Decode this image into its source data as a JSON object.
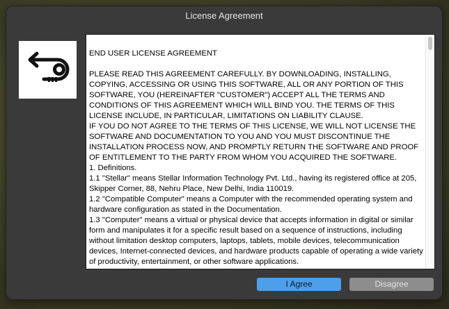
{
  "window": {
    "title": "License Agreement"
  },
  "logo": {
    "icon": "stellar-logo-icon"
  },
  "license": {
    "heading": "END USER LICENSE AGREEMENT",
    "paragraphs": [
      "PLEASE READ THIS AGREEMENT CAREFULLY. BY DOWNLOADING, INSTALLING, COPYING, ACCESSING OR USING THIS SOFTWARE, ALL OR ANY PORTION OF THIS SOFTWARE, YOU (HEREINAFTER \"CUSTOMER\") ACCEPT ALL THE TERMS AND CONDITIONS OF THIS AGREEMENT WHICH WILL BIND YOU. THE TERMS OF THIS LICENSE INCLUDE, IN PARTICULAR, LIMITATIONS ON LIABILITY CLAUSE.",
      "IF YOU DO NOT AGREE TO THE TERMS OF THIS LICENSE, WE WILL NOT LICENSE THE SOFTWARE AND DOCUMENTATION TO YOU AND YOU MUST DISCONTINUE THE INSTALLATION PROCESS NOW, AND PROMPTLY RETURN THE SOFTWARE AND PROOF OF ENTITLEMENT TO THE PARTY FROM WHOM YOU ACQUIRED THE SOFTWARE.",
      "1.    Definitions.",
      "1.1   \"Stellar\" means Stellar Information Technology Pvt. Ltd., having its registered office at 205, Skipper Corner, 88, Nehru Place, New Delhi, India 110019.",
      "1.2   \"Compatible Computer\" means a Computer with the recommended operating system and hardware configuration as stated in the Documentation.",
      "1.3   \"Computer\" means a virtual or physical device that accepts information in digital or similar form and manipulates it for a specific result based on a sequence of instructions, including without limitation desktop computers, laptops, tablets, mobile devices, telecommunication devices, Internet-connected devices, and hardware products capable of operating a wide variety of productivity, entertainment, or other software applications."
    ]
  },
  "buttons": {
    "agree_label": "I Agree",
    "disagree_label": "Disagree"
  },
  "colors": {
    "window_bg": "#3a3a3a",
    "agree_button": "#4e9fe9",
    "disagree_button": "#8d8d8d"
  }
}
